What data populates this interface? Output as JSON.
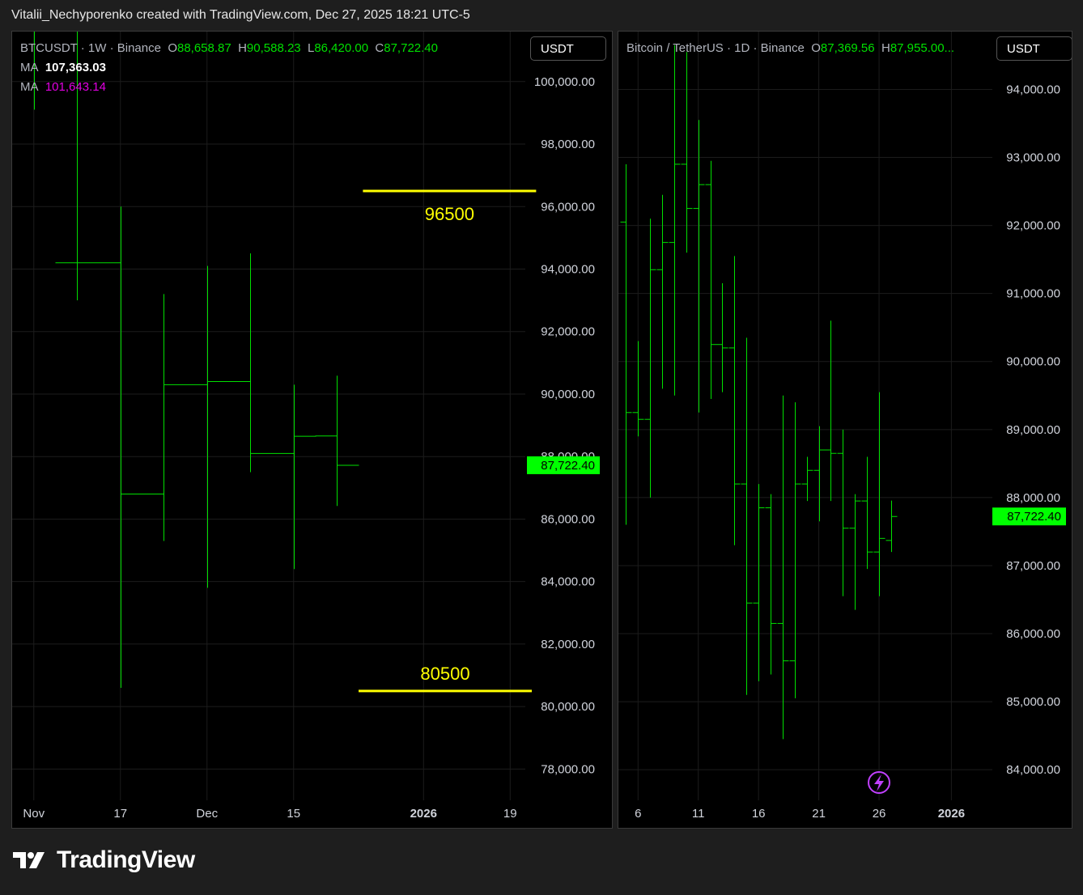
{
  "attribution": "Vitalii_Nechyporenko created with TradingView.com, Dec 27, 2025 18:21 UTC-5",
  "brand": "TradingView",
  "colors": {
    "up": "#00e000",
    "price_tag": "#00ff00",
    "level": "#ffff00",
    "ma2": "#e100e1",
    "bg": "#000000"
  },
  "icons": {
    "bolt": "lightning-icon",
    "logo": "tradingview-logo"
  },
  "chart_data": [
    {
      "type": "ohlc",
      "symbol": "BTCUSDT",
      "interval": "1W",
      "exchange": "Binance",
      "legend": {
        "o_label": "O",
        "o": "88,658.87",
        "h_label": "H",
        "h": "90,588.23",
        "l_label": "L",
        "l": "86,420.00",
        "c_label": "C",
        "c": "87,722.40"
      },
      "ma": [
        {
          "label": "MA",
          "value": "107,363.03"
        },
        {
          "label": "MA",
          "value": "101,643.14"
        }
      ],
      "unit": "USDT",
      "last_price": 87722.4,
      "last_price_label": "87,722.40",
      "ylim": [
        77000,
        101600
      ],
      "y_ticks": [
        78000,
        80000,
        82000,
        84000,
        86000,
        88000,
        90000,
        92000,
        94000,
        96000,
        98000,
        100000
      ],
      "y_tick_labels": [
        "78,000.00",
        "80,000.00",
        "82,000.00",
        "84,000.00",
        "86,000.00",
        "88,000.00",
        "90,000.00",
        "92,000.00",
        "94,000.00",
        "96,000.00",
        "98,000.00",
        "100,000.00"
      ],
      "x_ticks": [
        {
          "label": "Nov",
          "pos": -0.5
        },
        {
          "label": "17",
          "pos": 1.5
        },
        {
          "label": "Dec",
          "pos": 3.5
        },
        {
          "label": "15",
          "pos": 5.5
        },
        {
          "label": "2026",
          "pos": 8.5
        },
        {
          "label": "19",
          "pos": 10.5
        }
      ],
      "x_range": [
        -1.0,
        10.85
      ],
      "bars": [
        {
          "i": -0.5,
          "o": null,
          "h": 101800,
          "l": 99100,
          "c": null
        },
        {
          "i": 0.5,
          "o": 94200,
          "h": 101800,
          "l": 93000,
          "c": 94200
        },
        {
          "i": 1.5,
          "o": 94200,
          "h": 96000,
          "l": 80600,
          "c": 86800
        },
        {
          "i": 2.5,
          "o": 86800,
          "h": 93200,
          "l": 85300,
          "c": 90300
        },
        {
          "i": 3.5,
          "o": 90300,
          "h": 94100,
          "l": 83800,
          "c": 90400
        },
        {
          "i": 4.5,
          "o": 90400,
          "h": 94500,
          "l": 87500,
          "c": 88100
        },
        {
          "i": 5.5,
          "o": 88100,
          "h": 90300,
          "l": 84400,
          "c": 88650
        },
        {
          "i": 6.5,
          "o": 88659,
          "h": 90588,
          "l": 86420,
          "c": 87722
        }
      ],
      "levels": [
        {
          "value": 96500,
          "label": "96500",
          "x0": 7.1,
          "x1": 11.1
        },
        {
          "value": 80500,
          "label": "80500",
          "x0": 7.0,
          "x1": 11.0
        }
      ]
    },
    {
      "type": "ohlc",
      "symbol": "Bitcoin / TetherUS",
      "interval": "1D",
      "exchange": "Binance",
      "legend": {
        "o_label": "O",
        "o": "87,369.56",
        "h_label": "H",
        "h": "87,955.00..."
      },
      "unit": "USDT",
      "last_price": 87722.4,
      "last_price_label": "87,722.40",
      "ylim": [
        83550,
        94850
      ],
      "y_ticks": [
        84000,
        85000,
        86000,
        87000,
        88000,
        89000,
        90000,
        91000,
        92000,
        93000,
        94000
      ],
      "y_tick_labels": [
        "84,000.00",
        "85,000.00",
        "86,000.00",
        "87,000.00",
        "88,000.00",
        "89,000.00",
        "90,000.00",
        "91,000.00",
        "92,000.00",
        "93,000.00",
        "94,000.00"
      ],
      "x_ticks": [
        {
          "label": "6",
          "pos": 6
        },
        {
          "label": "11",
          "pos": 11
        },
        {
          "label": "16",
          "pos": 16
        },
        {
          "label": "21",
          "pos": 21
        },
        {
          "label": "26",
          "pos": 26
        },
        {
          "label": "2026",
          "pos": 32
        }
      ],
      "x_range": [
        4.37,
        35.4
      ],
      "bars": [
        {
          "d": 5,
          "o": 92050,
          "h": 92900,
          "l": 87600,
          "c": 89250
        },
        {
          "d": 6,
          "o": 89250,
          "h": 90300,
          "l": 88900,
          "c": 89150
        },
        {
          "d": 7,
          "o": 89150,
          "h": 92100,
          "l": 88000,
          "c": 91350
        },
        {
          "d": 8,
          "o": 91350,
          "h": 92450,
          "l": 89600,
          "c": 91750
        },
        {
          "d": 9,
          "o": 91750,
          "h": 94650,
          "l": 89500,
          "c": 92900
        },
        {
          "d": 10,
          "o": 92900,
          "h": 94550,
          "l": 91600,
          "c": 92250
        },
        {
          "d": 11,
          "o": 92250,
          "h": 93550,
          "l": 89250,
          "c": 92600
        },
        {
          "d": 12,
          "o": 92600,
          "h": 92950,
          "l": 89450,
          "c": 90250
        },
        {
          "d": 13,
          "o": 90250,
          "h": 91150,
          "l": 89550,
          "c": 90200
        },
        {
          "d": 14,
          "o": 90200,
          "h": 91550,
          "l": 87300,
          "c": 88200
        },
        {
          "d": 15,
          "o": 88200,
          "h": 90350,
          "l": 85100,
          "c": 86450
        },
        {
          "d": 16,
          "o": 86450,
          "h": 88200,
          "l": 85300,
          "c": 87850
        },
        {
          "d": 17,
          "o": 87850,
          "h": 88050,
          "l": 85400,
          "c": 86150
        },
        {
          "d": 18,
          "o": 86150,
          "h": 89500,
          "l": 84450,
          "c": 85600
        },
        {
          "d": 19,
          "o": 85600,
          "h": 89400,
          "l": 85050,
          "c": 88200
        },
        {
          "d": 20,
          "o": 88200,
          "h": 88600,
          "l": 87950,
          "c": 88400
        },
        {
          "d": 21,
          "o": 88400,
          "h": 89050,
          "l": 87650,
          "c": 88700
        },
        {
          "d": 22,
          "o": 88700,
          "h": 90600,
          "l": 87950,
          "c": 88650
        },
        {
          "d": 23,
          "o": 88650,
          "h": 89000,
          "l": 86550,
          "c": 87550
        },
        {
          "d": 24,
          "o": 87550,
          "h": 88050,
          "l": 86350,
          "c": 87950
        },
        {
          "d": 25,
          "o": 87950,
          "h": 88600,
          "l": 86950,
          "c": 87200
        },
        {
          "d": 26,
          "o": 87200,
          "h": 89550,
          "l": 86550,
          "c": 87400
        },
        {
          "d": 27,
          "o": 87370,
          "h": 87955,
          "l": 87200,
          "c": 87722
        }
      ]
    }
  ]
}
